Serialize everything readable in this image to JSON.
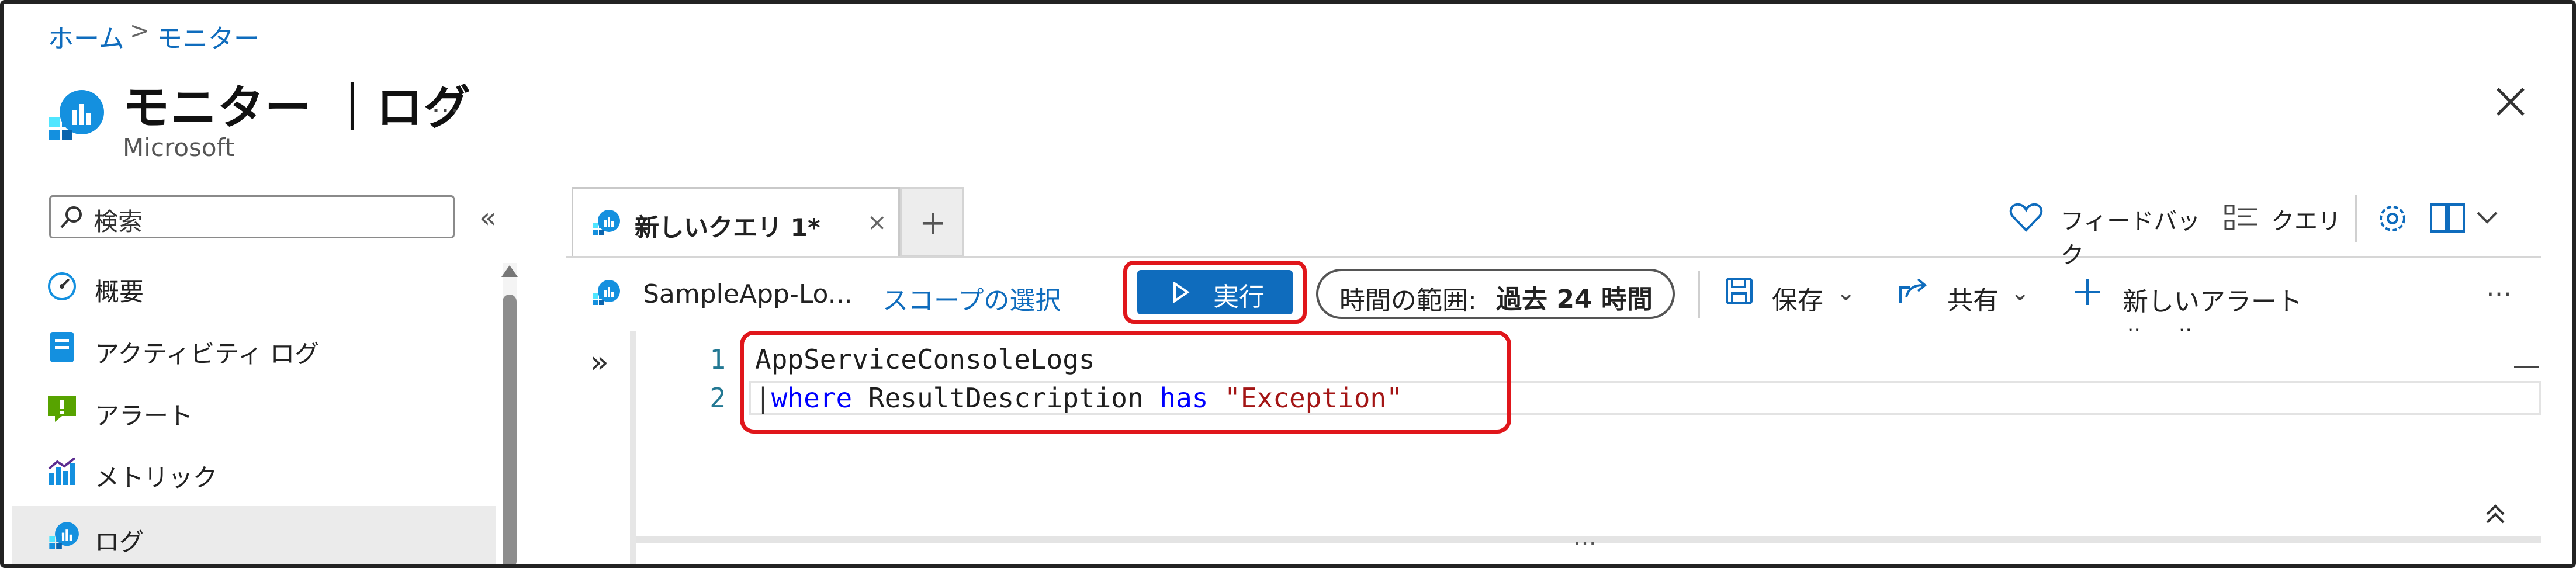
{
  "breadcrumb": {
    "home": "ホーム",
    "separator": ">",
    "current": "モニター"
  },
  "header": {
    "title": "モニター ｜ログ",
    "subtitle": "Microsoft",
    "more": "…"
  },
  "search": {
    "placeholder": "検索"
  },
  "collapse_label": "«",
  "nav": {
    "items": [
      {
        "label": "概要",
        "icon": "overview-gauge-icon"
      },
      {
        "label": "アクティビティ ログ",
        "icon": "activity-log-icon"
      },
      {
        "label": "アラート",
        "icon": "alert-icon"
      },
      {
        "label": "メトリック",
        "icon": "metrics-icon"
      },
      {
        "label": "ログ",
        "icon": "logs-icon",
        "selected": true
      }
    ]
  },
  "tabs": [
    {
      "label": "新しいクエリ 1*",
      "close": "×"
    }
  ],
  "add_tab": "+",
  "top_actions": {
    "feedback": "フィードバック",
    "queries": "クエリ"
  },
  "toolbar": {
    "scope": "SampleApp-Lo...",
    "select_scope": "スコープの選択",
    "run": "実行",
    "time_range_label": "時間の範囲:",
    "time_range_value": "過去 24 時間",
    "save": "保存",
    "share": "共有",
    "new_alert_rule": "新しいアラート ルール",
    "more": "…"
  },
  "editor": {
    "line_numbers": [
      "1",
      "2"
    ],
    "line1": "AppServiceConsoleLogs",
    "line2_pipe": "|",
    "line2_kw1": "where",
    "line2_ident": " ResultDescription ",
    "line2_kw2": "has",
    "line2_str": " \"Exception\"",
    "splitter": "…"
  },
  "colors": {
    "accent": "#0f6cbd",
    "highlight": "#e0161b",
    "keyword": "#0000ff",
    "string": "#a31515"
  }
}
